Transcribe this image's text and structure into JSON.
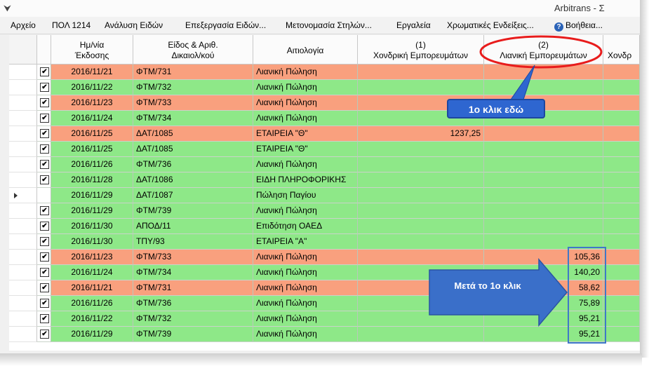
{
  "window": {
    "title": "Arbitrans - Σ"
  },
  "menu": [
    {
      "label": "Αρχείο"
    },
    {
      "label": "ΠΟΛ 1214"
    },
    {
      "label": "Ανάλυση Ειδών"
    },
    {
      "label": "Επεξεργασία Ειδών..."
    },
    {
      "label": "Μετονομασία Στηλών..."
    },
    {
      "label": "Εργαλεία"
    },
    {
      "label": "Χρωματικές Ενδείξεις..."
    },
    {
      "label": "Βοήθεια..."
    }
  ],
  "columns": [
    {
      "line1": "Ημ/νία",
      "line2": "Έκδοσης"
    },
    {
      "line1": "Είδος & Αριθ.",
      "line2": "Δικαιολ/κού"
    },
    {
      "line1": "Αιτιολογία",
      "line2": ""
    },
    {
      "line1": "(1)",
      "line2": "Χονδρική Εμπορευμάτων"
    },
    {
      "line1": "(2)",
      "line2": "Λιανική Εμπορευμάτων"
    },
    {
      "line1": "",
      "line2": "Χονδρ"
    }
  ],
  "rows": [
    {
      "date": "2016/11/21",
      "doc": "ΦΤΜ/731",
      "desc": "Λιανική Πώληση",
      "wholesale": "",
      "retail": "",
      "checked": true,
      "color": "#f9a07e"
    },
    {
      "date": "2016/11/22",
      "doc": "ΦΤΜ/732",
      "desc": "Λιανική Πώληση",
      "wholesale": "",
      "retail": "",
      "checked": true,
      "color": "#8ee888"
    },
    {
      "date": "2016/11/23",
      "doc": "ΦΤΜ/733",
      "desc": "Λιανική Πώληση",
      "wholesale": "",
      "retail": "",
      "checked": true,
      "color": "#f9a07e"
    },
    {
      "date": "2016/11/24",
      "doc": "ΦΤΜ/734",
      "desc": "Λιανική Πώληση",
      "wholesale": "",
      "retail": "",
      "checked": true,
      "color": "#8ee888"
    },
    {
      "date": "2016/11/25",
      "doc": "ΔΑΤ/1085",
      "desc": "ΕΤΑΙΡΕΙΑ \"Θ\"",
      "wholesale": "1237,25",
      "retail": "",
      "checked": true,
      "color": "#f9a07e"
    },
    {
      "date": "2016/11/25",
      "doc": "ΔΑΤ/1085",
      "desc": "ΕΤΑΙΡΕΙΑ \"Θ\"",
      "wholesale": "",
      "retail": "",
      "checked": true,
      "color": "#8ee888"
    },
    {
      "date": "2016/11/26",
      "doc": "ΦΤΜ/736",
      "desc": "Λιανική Πώληση",
      "wholesale": "",
      "retail": "",
      "checked": true,
      "color": "#8ee888"
    },
    {
      "date": "2016/11/28",
      "doc": "ΔΑΤ/1086",
      "desc": "ΕΙΔΗ ΠΛΗΡΟΦΟΡΙΚΗΣ",
      "wholesale": "",
      "retail": "",
      "checked": true,
      "color": "#8ee888"
    },
    {
      "date": "2016/11/29",
      "doc": "ΔΑΤ/1087",
      "desc": "Πώληση Παγίου",
      "wholesale": "",
      "retail": "",
      "checked": false,
      "color": "#8ee888",
      "current": true
    },
    {
      "date": "2016/11/29",
      "doc": "ΦΤΜ/739",
      "desc": "Λιανική Πώληση",
      "wholesale": "",
      "retail": "",
      "checked": true,
      "color": "#8ee888"
    },
    {
      "date": "2016/11/30",
      "doc": "ΑΠΟΔ/11",
      "desc": "Επιδότηση ΟΑΕΔ",
      "wholesale": "",
      "retail": "",
      "checked": true,
      "color": "#8ee888"
    },
    {
      "date": "2016/11/30",
      "doc": "ΤΠΥ/93",
      "desc": "ΕΤΑΙΡΕΙΑ \"Α\"",
      "wholesale": "",
      "retail": "",
      "checked": true,
      "color": "#8ee888"
    },
    {
      "date": "2016/11/23",
      "doc": "ΦΤΜ/733",
      "desc": "Λιανική Πώληση",
      "wholesale": "",
      "retail": "105,36",
      "checked": true,
      "color": "#f9a07e"
    },
    {
      "date": "2016/11/24",
      "doc": "ΦΤΜ/734",
      "desc": "Λιανική Πώληση",
      "wholesale": "",
      "retail": "140,20",
      "checked": true,
      "color": "#8ee888"
    },
    {
      "date": "2016/11/21",
      "doc": "ΦΤΜ/731",
      "desc": "Λιανική Πώληση",
      "wholesale": "",
      "retail": "58,62",
      "checked": true,
      "color": "#f9a07e"
    },
    {
      "date": "2016/11/26",
      "doc": "ΦΤΜ/736",
      "desc": "Λιανική Πώληση",
      "wholesale": "",
      "retail": "75,89",
      "checked": true,
      "color": "#8ee888"
    },
    {
      "date": "2016/11/22",
      "doc": "ΦΤΜ/732",
      "desc": "Λιανική Πώληση",
      "wholesale": "",
      "retail": "95,21",
      "checked": true,
      "color": "#8ee888"
    },
    {
      "date": "2016/11/29",
      "doc": "ΦΤΜ/739",
      "desc": "Λιανική Πώληση",
      "wholesale": "",
      "retail": "95,21",
      "checked": true,
      "color": "#8ee888"
    }
  ],
  "annotations": {
    "callout": "1ο κλικ εδώ",
    "arrow": "Μετά το 1ο κλικ",
    "accent_red": "#e81c1c",
    "accent_blue": "#2e66d0"
  }
}
